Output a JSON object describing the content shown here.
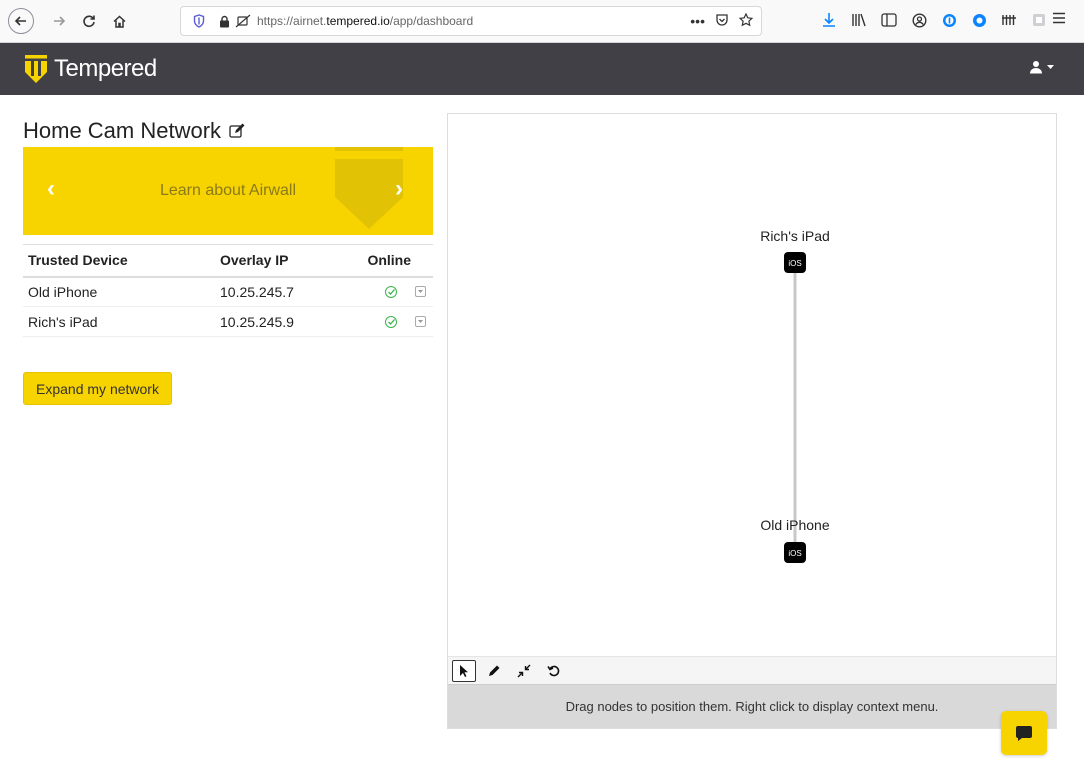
{
  "browser": {
    "url_prefix": "https://airnet.",
    "url_domain": "tempered.io",
    "url_path": "/app/dashboard",
    "more": "•••"
  },
  "app": {
    "brand": "Tempered",
    "brand_color": "#f7d300",
    "header_color": "#414046"
  },
  "network": {
    "title": "Home Cam Network"
  },
  "banner": {
    "text": "Learn about Airwall",
    "prev": "‹",
    "next": "›"
  },
  "devices": {
    "headers": [
      "Trusted Device",
      "Overlay IP",
      "Online"
    ],
    "rows": [
      {
        "name": "Old iPhone",
        "ip": "10.25.245.7",
        "online": true
      },
      {
        "name": "Rich's iPad",
        "ip": "10.25.245.9",
        "online": true
      }
    ]
  },
  "actions": {
    "expand": "Expand my network"
  },
  "graph": {
    "nodes": [
      {
        "label": "Rich's iPad",
        "type": "iOS"
      },
      {
        "label": "Old iPhone",
        "type": "iOS"
      }
    ],
    "hint": "Drag nodes to position them. Right click to display context menu."
  }
}
